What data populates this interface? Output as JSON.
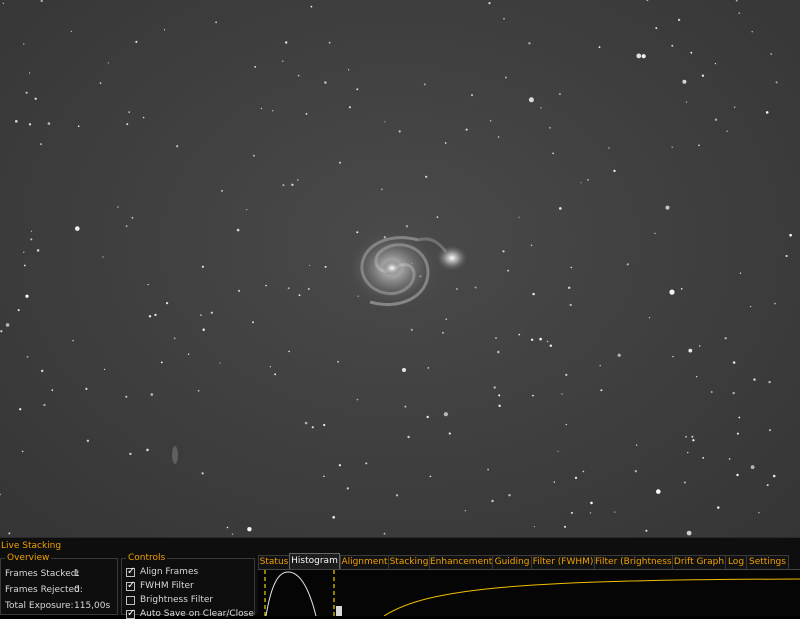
{
  "panel": {
    "title": "Live Stacking",
    "overview": {
      "legend": "Overview",
      "rows": [
        {
          "label": "Frames Stacked:",
          "value": "1"
        },
        {
          "label": "Frames Rejected:",
          "value": "0"
        },
        {
          "label": "Total Exposure:",
          "value": "115,00s"
        }
      ]
    },
    "controls": {
      "legend": "Controls",
      "items": [
        {
          "label": "Align Frames",
          "checked": true
        },
        {
          "label": "FWHM Filter",
          "checked": true
        },
        {
          "label": "Brightness Filter",
          "checked": false
        },
        {
          "label": "Auto Save on Clear/Close",
          "checked": true
        }
      ]
    },
    "tabs": [
      "Status",
      "Histogram",
      "Alignment",
      "Stacking",
      "Enhancement",
      "Guiding",
      "Filter (FWHM)",
      "Filter (Brightness)",
      "Drift Graph",
      "Log",
      "Settings"
    ],
    "active_tab": "Histogram"
  },
  "colors": {
    "accent": "#f0a000",
    "histogram_line": "#f0c000",
    "marker": "#f5d000",
    "background": "#3e3e3e"
  }
}
